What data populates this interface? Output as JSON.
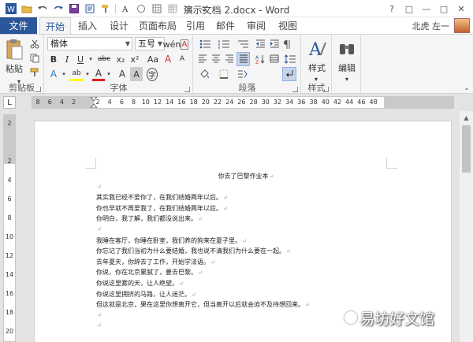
{
  "title": {
    "text": "演示文档 2.docx - Word"
  },
  "window_buttons": [
    "?",
    "□",
    "—",
    "□",
    "✕"
  ],
  "tabs": [
    {
      "label": "文件"
    },
    {
      "label": "开始"
    },
    {
      "label": "插入"
    },
    {
      "label": "设计"
    },
    {
      "label": "页面布局"
    },
    {
      "label": "引用"
    },
    {
      "label": "邮件"
    },
    {
      "label": "审阅"
    },
    {
      "label": "视图"
    }
  ],
  "user": {
    "name": "北虎 左一"
  },
  "ribbon": {
    "clipboard": {
      "paste_label": "粘贴",
      "group_label": "剪贴板"
    },
    "font": {
      "font_name": "楷体",
      "font_size": "五号",
      "group_label": "字体",
      "buttons": {
        "bold": "B",
        "italic": "I",
        "underline": "U",
        "strike": "abc",
        "sub": "x₂",
        "sup": "x²",
        "grow": "A",
        "shrink": "A",
        "case": "Aa",
        "clear": "A",
        "phonetic": "wén",
        "border": "A",
        "effect": "A",
        "highlight": "ab",
        "color": "A",
        "shade": "A",
        "enclose": "字"
      }
    },
    "paragraph": {
      "group_label": "段落"
    },
    "styles": {
      "label": "样式",
      "group_label": "样式"
    },
    "editing": {
      "label": "编辑"
    }
  },
  "colors": {
    "accent": "#2b579a",
    "highlight_yellow": "#ffff00",
    "font_red": "#e02020"
  },
  "ruler": {
    "corner": "L",
    "ticks": [
      "8",
      "6",
      "4",
      "2",
      "",
      "2",
      "4",
      "6",
      "8",
      "10",
      "12",
      "14",
      "16",
      "18",
      "20",
      "22",
      "24",
      "26",
      "28",
      "30",
      "32",
      "34",
      "36",
      "38",
      "40",
      "42",
      "44",
      "46",
      "48"
    ]
  },
  "vruler": {
    "ticks": [
      "2",
      "",
      "2",
      "4",
      "6",
      "8",
      "10",
      "12",
      "14",
      "16",
      "18",
      "20"
    ]
  },
  "document": {
    "lines": [
      {
        "text": "你去了巴黎作业本",
        "title": true
      },
      {
        "text": ""
      },
      {
        "text": "其实我已经不爱你了，在我们结婚两年以后。"
      },
      {
        "text": "你也早就不再爱我了，在我们结婚两年以后。"
      },
      {
        "text": "你明白，我了解，我们都没说出来。"
      },
      {
        "text": ""
      },
      {
        "text": "我睡在客厅，你睡在卧室，我们养的狗来在夏子里。"
      },
      {
        "text": "你忘记了我们当初为什么要结婚，我也说不清我们为什么要在一起。"
      },
      {
        "text": "去年夏天，你辞去了工作，开始学法语。"
      },
      {
        "text": "你说，你在北京累腻了，要去巴黎。"
      },
      {
        "text": "你说这里雾的天，让人绝望。"
      },
      {
        "text": "你说这里拥挤的马路，让人迷茫。"
      },
      {
        "text": "但这就是北京，果在这里你想离开它，但当离开以后就会迫不及待想回来。"
      },
      {
        "text": ""
      },
      {
        "text": ""
      }
    ]
  },
  "watermark": {
    "text": "易坊好文馆"
  }
}
